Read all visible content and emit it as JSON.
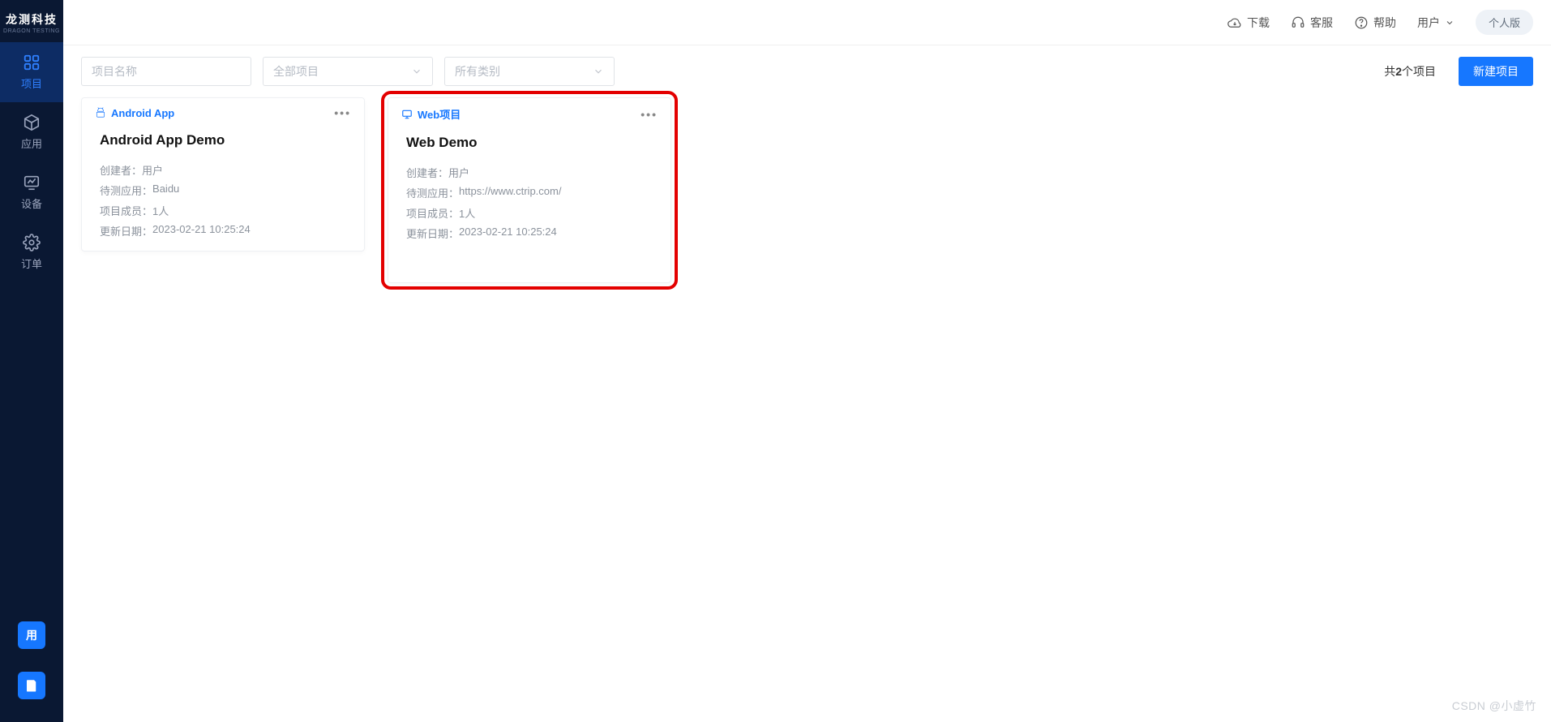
{
  "brand": {
    "name": "龙测科技",
    "sub": "DRAGON TESTING"
  },
  "sidebar": {
    "items": [
      {
        "label": "项目"
      },
      {
        "label": "应用"
      },
      {
        "label": "设备"
      },
      {
        "label": "订单"
      }
    ],
    "bottom_user_label": "用"
  },
  "header": {
    "download": "下载",
    "support": "客服",
    "help": "帮助",
    "user": "用户",
    "version": "个人版"
  },
  "toolbar": {
    "search_placeholder": "项目名称",
    "select_project": "全部项目",
    "select_category": "所有类别",
    "count_prefix": "共",
    "count_value": "2",
    "count_suffix": "个项目",
    "new_button": "新建项目"
  },
  "labels": {
    "creator": "创建者",
    "target_app": "待测应用",
    "members": "项目成员",
    "updated": "更新日期"
  },
  "cards": [
    {
      "type_label": "Android App",
      "title": "Android App Demo",
      "creator": "用户",
      "target_app": "Baidu",
      "members": "1人",
      "updated": "2023-02-21 10:25:24",
      "highlight": false,
      "icon": "android"
    },
    {
      "type_label": "Web项目",
      "title": "Web Demo",
      "creator": "用户",
      "target_app": "https://www.ctrip.com/",
      "members": "1人",
      "updated": "2023-02-21 10:25:24",
      "highlight": true,
      "icon": "web"
    }
  ],
  "watermark": "CSDN @小虚竹"
}
